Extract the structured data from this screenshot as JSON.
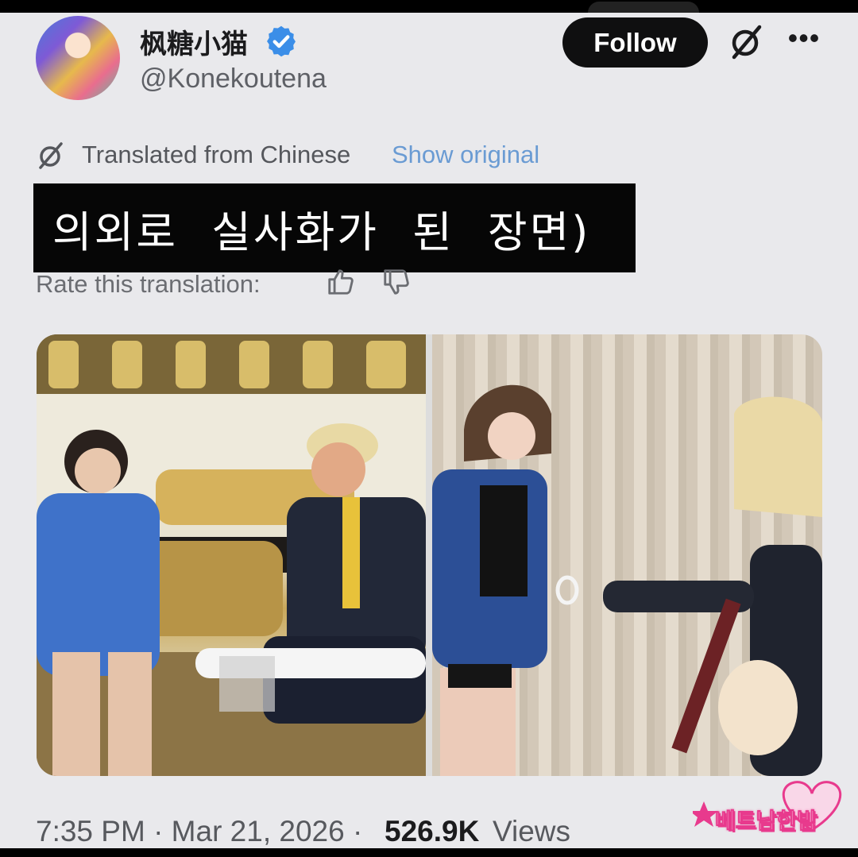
{
  "post": {
    "author": {
      "display_name": "枫糖小猫",
      "handle": "@Konekoutena",
      "verified": true
    },
    "follow_label": "Follow",
    "translation": {
      "label": "Translated from Chinese",
      "show_original": "Show original",
      "rate_label": "Rate this translation:"
    },
    "text": "의외로 실사화가 된 장면)",
    "meta": {
      "time": "7:35 PM · Mar 21, 2026 · ",
      "views_count": "526.9K",
      "views_label": "Views"
    },
    "media_count": 2
  },
  "watermark": {
    "text": "베트남한밤"
  },
  "colors": {
    "background": "#e9e9ec",
    "follow_button": "#0f0f10",
    "link_blue": "#6a9bd3",
    "verified_blue": "#3b8ee8",
    "text_black_box": "#060606",
    "watermark_pink": "#e83a8d"
  },
  "icons": [
    "verified-badge-icon",
    "grok-icon",
    "more-icon",
    "translate-icon",
    "thumbs-up-icon",
    "thumbs-down-icon"
  ]
}
